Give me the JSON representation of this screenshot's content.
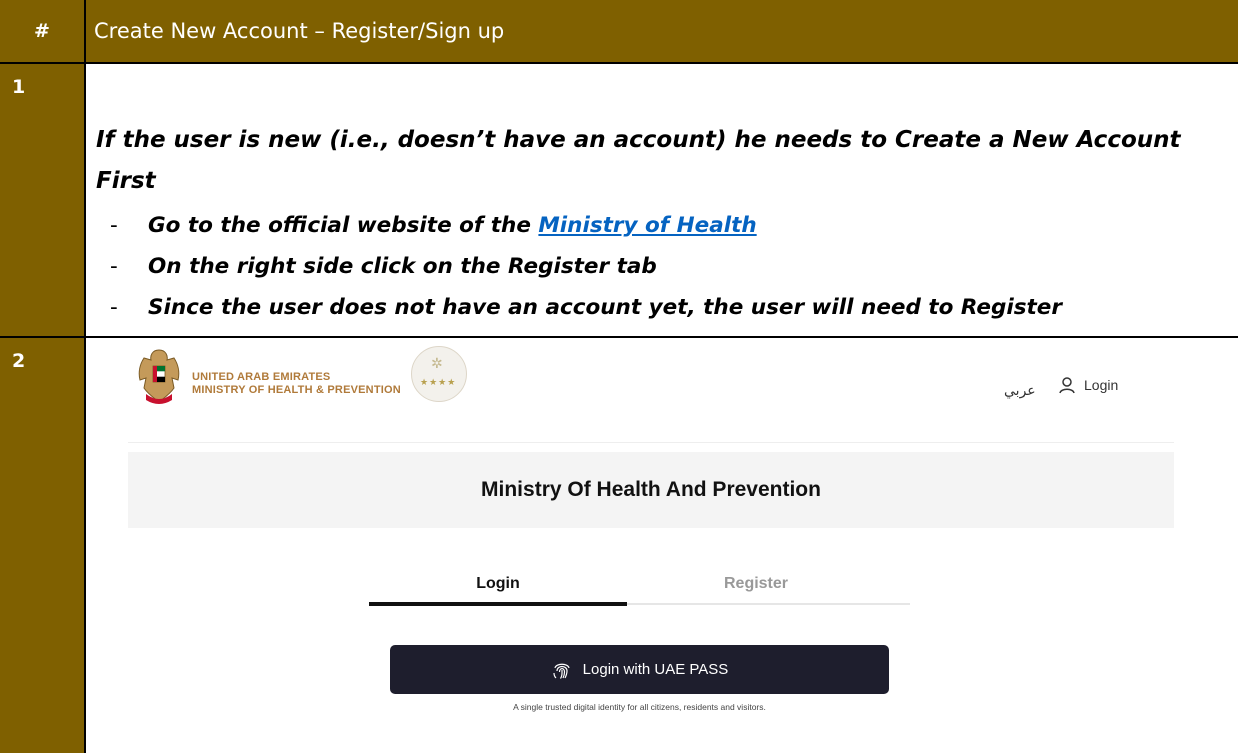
{
  "table": {
    "header_num": "#",
    "header_title": "Create New Account – Register/Sign up",
    "rows": [
      {
        "num": "1"
      },
      {
        "num": "2"
      }
    ]
  },
  "step1": {
    "intro": "If the user is new (i.e., doesn’t have an account) he needs to Create a New Account First",
    "bullet1_prefix": "Go to the official website of the ",
    "bullet1_link": "Ministry of Health",
    "bullet2": "On the right side click on the Register tab",
    "bullet3": "Since the user does not have an account yet, the user will need to Register",
    "bullet_marker": "-"
  },
  "screenshot": {
    "org_line1": "UNITED ARAB EMIRATES",
    "org_line2": "MINISTRY OF HEALTH & PREVENTION",
    "lang_toggle": "عربي",
    "login_link": "Login",
    "banner_title": "Ministry Of Health And Prevention",
    "tabs": {
      "login": "Login",
      "register": "Register",
      "active": "login"
    },
    "uae_pass_button": "Login with UAE PASS",
    "tagline": "A single trusted digital identity for all citizens, residents and visitors.",
    "icons": [
      "uae-emblem-icon",
      "star-rating-badge-icon",
      "user-icon",
      "fingerprint-icon"
    ]
  },
  "colors": {
    "header_bg": "#7f6000",
    "link": "#0563c1",
    "button_bg": "#1e1e2d",
    "org_text": "#b07a3a"
  }
}
